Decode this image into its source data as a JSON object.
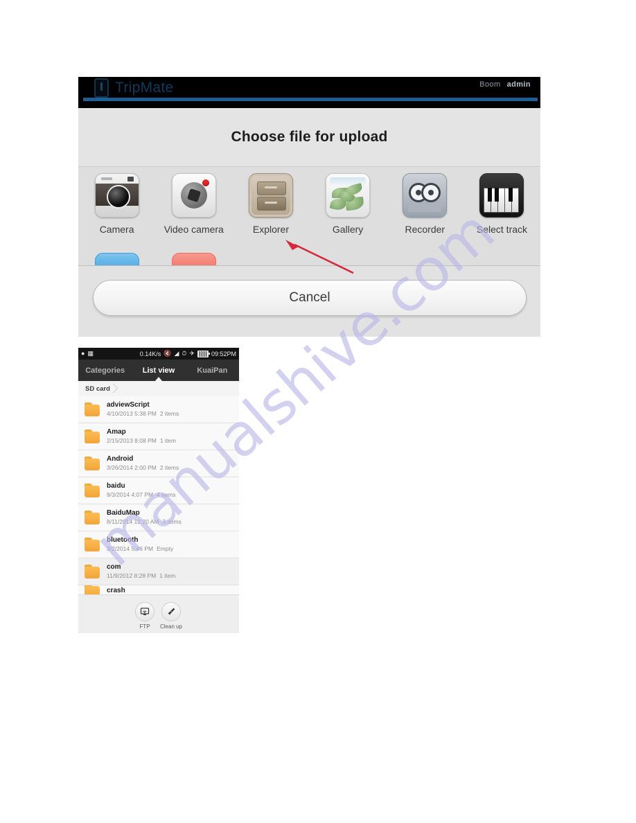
{
  "upload_dialog": {
    "brand": "TripMate",
    "brand_icon": "device-icon",
    "user_left": "Boom",
    "user_right": "admin",
    "title": "Choose file for upload",
    "apps": [
      {
        "label": "Camera",
        "icon": "camera-icon"
      },
      {
        "label": "Video camera",
        "icon": "video-camera-icon"
      },
      {
        "label": "Explorer",
        "icon": "file-explorer-icon"
      },
      {
        "label": "Gallery",
        "icon": "gallery-icon"
      },
      {
        "label": "Recorder",
        "icon": "tape-recorder-icon"
      },
      {
        "label": "Select track",
        "icon": "piano-keys-icon"
      }
    ],
    "cancel_label": "Cancel",
    "accent_color": "#1c5f93",
    "annotation": {
      "type": "arrow",
      "color": "#d42a3c",
      "points_at": "Explorer"
    }
  },
  "phone": {
    "status_bar": {
      "icons_left": [
        "shield-icon",
        "picture-icon"
      ],
      "network_speed": "0.14K/s",
      "icons_right": [
        "mute-icon",
        "wifi-icon",
        "alarm-icon",
        "airplane-icon",
        "battery-icon"
      ],
      "time": "09:52PM"
    },
    "tabs": [
      {
        "label": "Categories",
        "active": false
      },
      {
        "label": "List view",
        "active": true
      },
      {
        "label": "KuaiPan",
        "active": false
      }
    ],
    "breadcrumb": "SD card",
    "columns": [
      "name",
      "modified",
      "items"
    ],
    "files": [
      {
        "name": "adviewScript",
        "modified": "4/10/2013 5:38 PM",
        "count": "2 items",
        "icon": "folder-icon"
      },
      {
        "name": "Amap",
        "modified": "2/15/2013 8:08 PM",
        "count": "1 item",
        "icon": "folder-icon"
      },
      {
        "name": "Android",
        "modified": "3/26/2014 2:00 PM",
        "count": "2 items",
        "icon": "folder-icon"
      },
      {
        "name": "baidu",
        "modified": "9/3/2014 4:07 PM",
        "count": "4 items",
        "icon": "folder-icon"
      },
      {
        "name": "BaiduMap",
        "modified": "8/11/2014 12:20 AM",
        "count": "3 items",
        "icon": "folder-icon"
      },
      {
        "name": "bluetooth",
        "modified": "3/2/2014 5:46 PM",
        "count": "Empty",
        "icon": "folder-icon"
      },
      {
        "name": "com",
        "modified": "11/9/2012 8:28 PM",
        "count": "1 item",
        "icon": "folder-icon"
      },
      {
        "name": "crash",
        "modified": "",
        "count": "",
        "icon": "folder-icon"
      }
    ],
    "bottom_bar": [
      {
        "label": "FTP",
        "icon": "ftp-monitor-icon"
      },
      {
        "label": "Clean up",
        "icon": "broom-icon"
      }
    ]
  },
  "watermark": {
    "text": "manualshive.com",
    "color": "#b9b6e8"
  }
}
